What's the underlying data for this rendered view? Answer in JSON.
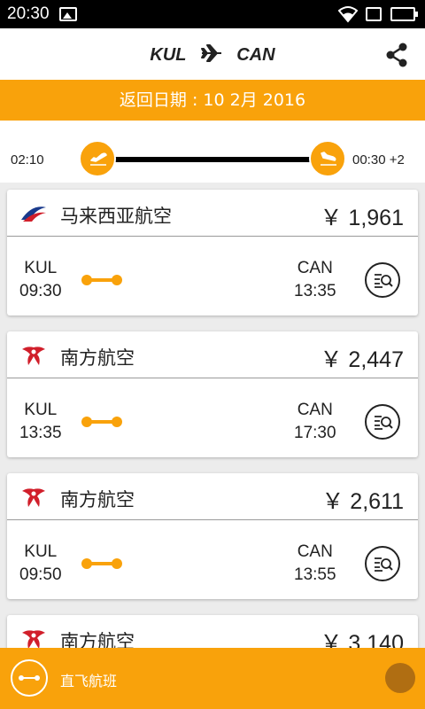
{
  "status": {
    "time": "20:30"
  },
  "header": {
    "origin": "KUL",
    "destination": "CAN"
  },
  "date_bar": {
    "text": "返回日期 : 10 2月 2016"
  },
  "time_filter": {
    "start": "02:10",
    "end": "00:30 +2"
  },
  "colors": {
    "accent": "#f9a20b",
    "fab": "#b06e12",
    "text": "#222222"
  },
  "flights": [
    {
      "airline": "马来西亚航空",
      "logo": "malaysia-airlines-logo-icon",
      "price": "￥ 1,961",
      "from_code": "KUL",
      "depart": "09:30",
      "to_code": "CAN",
      "arrive": "13:35"
    },
    {
      "airline": "南方航空",
      "logo": "china-southern-logo-icon",
      "price": "￥ 2,447",
      "from_code": "KUL",
      "depart": "13:35",
      "to_code": "CAN",
      "arrive": "17:30"
    },
    {
      "airline": "南方航空",
      "logo": "china-southern-logo-icon",
      "price": "￥ 2,611",
      "from_code": "KUL",
      "depart": "09:50",
      "to_code": "CAN",
      "arrive": "13:55"
    },
    {
      "airline": "南方航空",
      "logo": "china-southern-logo-icon",
      "price": "￥ 3,140"
    }
  ],
  "bottom_bar": {
    "label": "直飞航班"
  }
}
